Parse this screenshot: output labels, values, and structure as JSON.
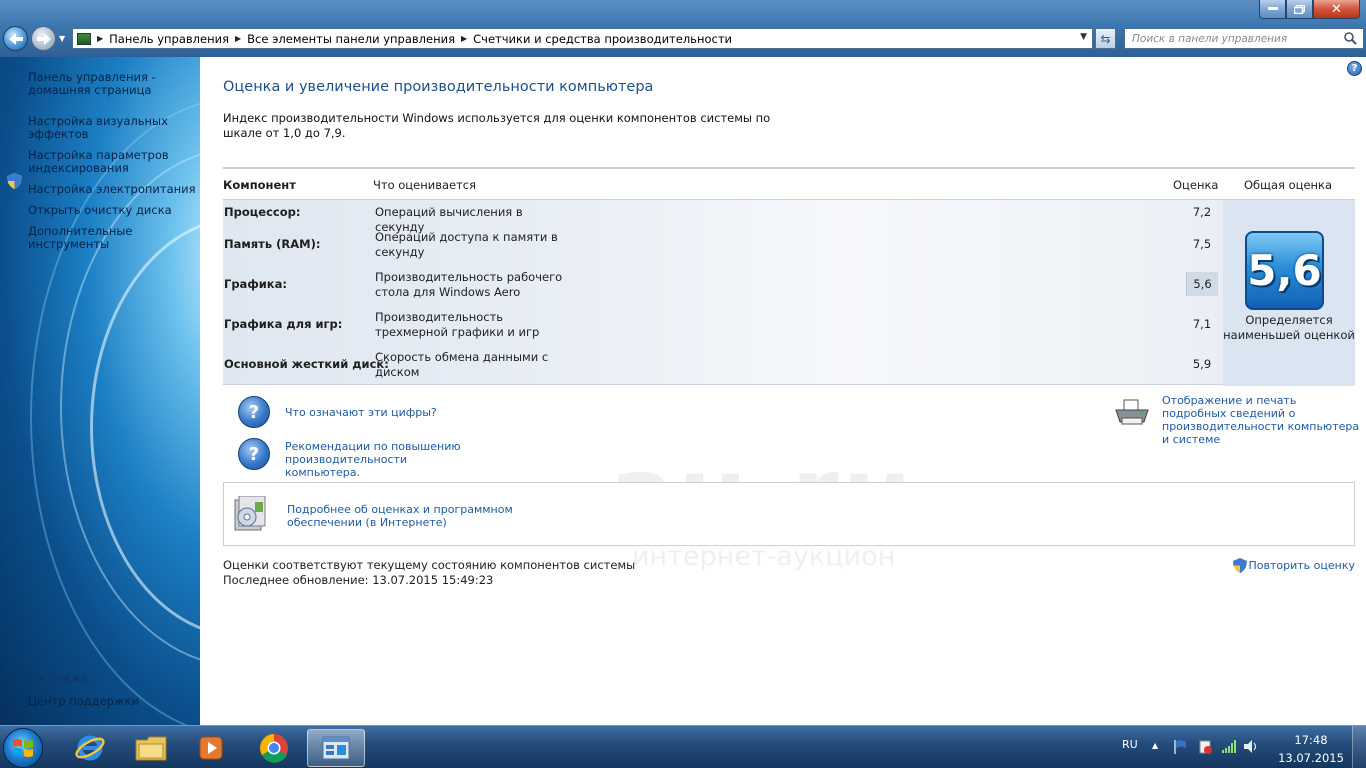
{
  "window": {
    "minimize_label": "",
    "maximize_label": "",
    "close_label": "✕"
  },
  "nav": {
    "breadcrumbs": [
      {
        "label": "Панель управления"
      },
      {
        "label": "Все элементы панели управления"
      },
      {
        "label": "Счетчики и средства производительности"
      }
    ],
    "search_placeholder": "Поиск в панели управления"
  },
  "sidebar": {
    "items": [
      {
        "label": "Панель управления - домашняя страница"
      },
      {
        "label": "Настройка визуальных эффектов"
      },
      {
        "label": "Настройка параметров индексирования"
      },
      {
        "label": "Настройка электропитания"
      },
      {
        "label": "Открыть очистку диска"
      },
      {
        "label": "Дополнительные инструменты"
      }
    ],
    "see_also": "См. также",
    "bottom_link": "Центр поддержки"
  },
  "main": {
    "title": "Оценка и увеличение производительности компьютера",
    "intro": "Индекс производительности Windows используется для оценки компонентов системы по шкале от 1,0 до 7,9.",
    "table": {
      "headers": {
        "component": "Компонент",
        "what": "Что оценивается",
        "score": "Оценка",
        "base": "Общая оценка"
      },
      "rows": [
        {
          "name": "Процессор:",
          "what": "Операций вычисления в секунду",
          "score": "7,2"
        },
        {
          "name": "Память (RAM):",
          "what": "Операций доступа к памяти в секунду",
          "score": "7,5"
        },
        {
          "name": "Графика:",
          "what": "Производительность рабочего стола для Windows Aero",
          "score": "5,6"
        },
        {
          "name": "Графика для игр:",
          "what": "Производительность трехмерной графики и игр",
          "score": "7,1"
        },
        {
          "name": "Основной жесткий диск:",
          "what": "Скорость обмена данными с диском",
          "score": "5,9"
        }
      ],
      "base_score": "5,6",
      "base_note": "Определяется наименьшей оценкой"
    },
    "links": {
      "what_numbers": "Что означают эти цифры?",
      "recommendations": "Рекомендации по повышению производительности компьютера.",
      "print_details": "Отображение и печать подробных сведений о производительности компьютера и системе",
      "more_info": "Подробнее об оценках и программном обеспечении (в Интернете)"
    },
    "status_line_1": "Оценки соответствуют текущему состоянию компонентов системы",
    "status_line_2": "Последнее обновление: 13.07.2015 15:49:23",
    "repeat_label": "Повторить оценку",
    "watermark_big": "au.ru",
    "watermark_small": "интернет-аукцион"
  },
  "taskbar": {
    "lang": "RU",
    "time": "17:48",
    "date": "13.07.2015"
  },
  "colors": {
    "accent": "#1e4f8d",
    "link": "#1d5aa4",
    "badge": "#2b8fd8"
  }
}
